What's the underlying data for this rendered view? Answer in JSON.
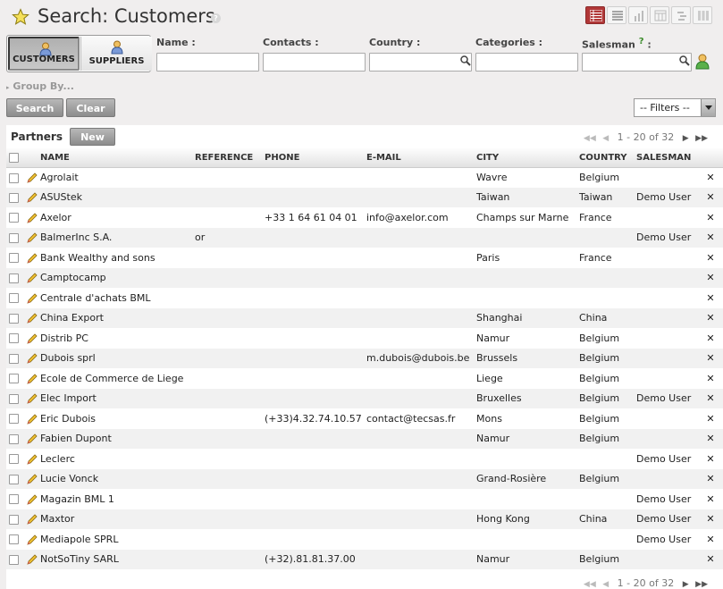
{
  "header": {
    "title": "Search: Customers",
    "help": "?",
    "views": [
      {
        "name": "list",
        "active": true
      },
      {
        "name": "form",
        "active": false
      },
      {
        "name": "graph",
        "active": false
      },
      {
        "name": "calendar",
        "active": false
      },
      {
        "name": "gantt",
        "active": false
      },
      {
        "name": "kanban",
        "active": false
      }
    ]
  },
  "filters": {
    "customers_label": "CUSTOMERS",
    "suppliers_label": "SUPPLIERS"
  },
  "search_fields": {
    "name_label": "Name :",
    "contacts_label": "Contacts :",
    "country_label": "Country :",
    "categories_label": "Categories :",
    "salesman_label": "Salesman",
    "salesman_help": "?",
    "salesman_colon": ":"
  },
  "group_by": "Group By...",
  "buttons": {
    "search": "Search",
    "clear": "Clear",
    "filters": "-- Filters --"
  },
  "list": {
    "title": "Partners",
    "new_label": "New",
    "pager": "1 - 20 of 32",
    "columns": [
      "NAME",
      "REFERENCE",
      "PHONE",
      "E-MAIL",
      "CITY",
      "COUNTRY",
      "SALESMAN"
    ],
    "rows": [
      {
        "name": "Agrolait",
        "ref": "",
        "phone": "",
        "email": "",
        "city": "Wavre",
        "country": "Belgium",
        "salesman": ""
      },
      {
        "name": "ASUStek",
        "ref": "",
        "phone": "",
        "email": "",
        "city": "Taiwan",
        "country": "Taiwan",
        "salesman": "Demo User"
      },
      {
        "name": "Axelor",
        "ref": "",
        "phone": "+33 1 64 61 04 01",
        "email": "info@axelor.com",
        "city": "Champs sur Marne",
        "country": "France",
        "salesman": ""
      },
      {
        "name": "BalmerInc S.A.",
        "ref": "or",
        "phone": "",
        "email": "",
        "city": "",
        "country": "",
        "salesman": "Demo User"
      },
      {
        "name": "Bank Wealthy and sons",
        "ref": "",
        "phone": "",
        "email": "",
        "city": "Paris",
        "country": "France",
        "salesman": ""
      },
      {
        "name": "Camptocamp",
        "ref": "",
        "phone": "",
        "email": "",
        "city": "",
        "country": "",
        "salesman": ""
      },
      {
        "name": "Centrale d'achats BML",
        "ref": "",
        "phone": "",
        "email": "",
        "city": "",
        "country": "",
        "salesman": ""
      },
      {
        "name": "China Export",
        "ref": "",
        "phone": "",
        "email": "",
        "city": "Shanghai",
        "country": "China",
        "salesman": ""
      },
      {
        "name": "Distrib PC",
        "ref": "",
        "phone": "",
        "email": "",
        "city": "Namur",
        "country": "Belgium",
        "salesman": ""
      },
      {
        "name": "Dubois sprl",
        "ref": "",
        "phone": "",
        "email": "m.dubois@dubois.be",
        "city": "Brussels",
        "country": "Belgium",
        "salesman": ""
      },
      {
        "name": "Ecole de Commerce de Liege",
        "ref": "",
        "phone": "",
        "email": "",
        "city": "Liege",
        "country": "Belgium",
        "salesman": ""
      },
      {
        "name": "Elec Import",
        "ref": "",
        "phone": "",
        "email": "",
        "city": "Bruxelles",
        "country": "Belgium",
        "salesman": "Demo User"
      },
      {
        "name": "Eric Dubois",
        "ref": "",
        "phone": "(+33)4.32.74.10.57",
        "email": "contact@tecsas.fr",
        "city": "Mons",
        "country": "Belgium",
        "salesman": ""
      },
      {
        "name": "Fabien Dupont",
        "ref": "",
        "phone": "",
        "email": "",
        "city": "Namur",
        "country": "Belgium",
        "salesman": ""
      },
      {
        "name": "Leclerc",
        "ref": "",
        "phone": "",
        "email": "",
        "city": "",
        "country": "",
        "salesman": "Demo User"
      },
      {
        "name": "Lucie Vonck",
        "ref": "",
        "phone": "",
        "email": "",
        "city": "Grand-Rosière",
        "country": "Belgium",
        "salesman": ""
      },
      {
        "name": "Magazin BML 1",
        "ref": "",
        "phone": "",
        "email": "",
        "city": "",
        "country": "",
        "salesman": "Demo User"
      },
      {
        "name": "Maxtor",
        "ref": "",
        "phone": "",
        "email": "",
        "city": "Hong Kong",
        "country": "China",
        "salesman": "Demo User"
      },
      {
        "name": "Mediapole SPRL",
        "ref": "",
        "phone": "",
        "email": "",
        "city": "",
        "country": "",
        "salesman": "Demo User"
      },
      {
        "name": "NotSoTiny SARL",
        "ref": "",
        "phone": "(+32).81.81.37.00",
        "email": "",
        "city": "Namur",
        "country": "Belgium",
        "salesman": ""
      }
    ]
  }
}
